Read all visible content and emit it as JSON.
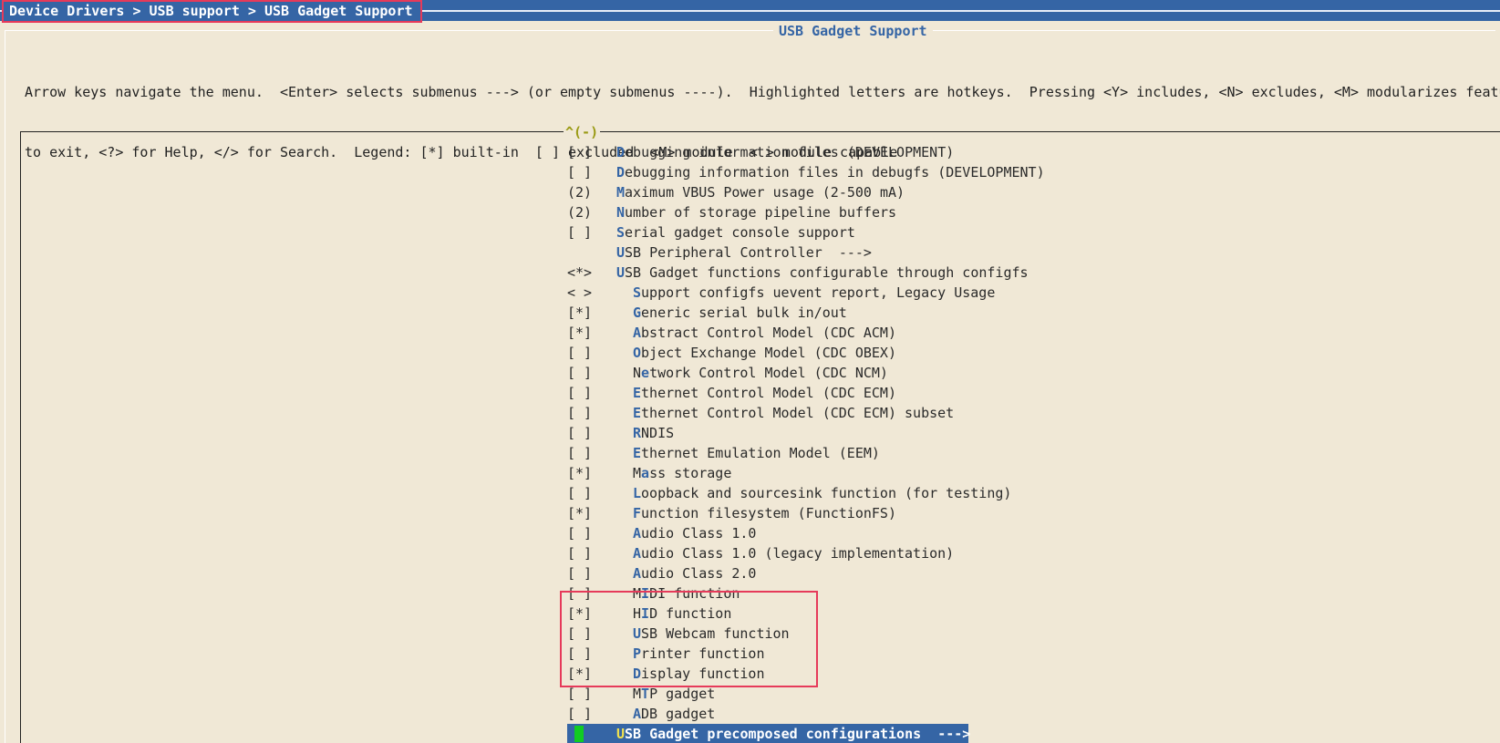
{
  "breadcrumb": "Device Drivers > USB support > USB Gadget Support",
  "dialog_title": "USB Gadget Support",
  "help_lines": [
    "Arrow keys navigate the menu.  <Enter> selects submenus ---> (or empty submenus ----).  Highlighted letters are hotkeys.  Pressing <Y> includes, <N> excludes, <M> modularizes featu",
    "to exit, <?> for Help, </> for Search.  Legend: [*] built-in  [ ] excluded  <M> module  < > module capable"
  ],
  "scroll_indicator": "^(-)",
  "menu_items": [
    {
      "state": "[ ]",
      "hotkey": "D",
      "rest": "ebugging information files (DEVELOPMENT)",
      "indent": false,
      "name": "debugging-info-files"
    },
    {
      "state": "[ ]",
      "hotkey": "D",
      "rest": "ebugging information files in debugfs (DEVELOPMENT)",
      "indent": false,
      "name": "debugging-info-debugfs"
    },
    {
      "state": "(2)",
      "hotkey": "M",
      "rest": "aximum VBUS Power usage (2-500 mA)",
      "indent": false,
      "name": "max-vbus-power"
    },
    {
      "state": "(2)",
      "hotkey": "N",
      "rest": "umber of storage pipeline buffers",
      "indent": false,
      "name": "storage-pipeline-buffers"
    },
    {
      "state": "[ ]",
      "hotkey": "S",
      "rest": "erial gadget console support",
      "indent": false,
      "name": "serial-gadget-console"
    },
    {
      "state": "",
      "hotkey": "U",
      "rest": "SB Peripheral Controller  --->",
      "indent": false,
      "name": "usb-peripheral-controller"
    },
    {
      "state": "<*>",
      "hotkey": "U",
      "rest": "SB Gadget functions configurable through configfs",
      "indent": false,
      "name": "usb-gadget-configfs"
    },
    {
      "state": "< >",
      "hotkey": "S",
      "rest": "upport configfs uevent report, Legacy Usage",
      "indent": true,
      "name": "configfs-uevent-report"
    },
    {
      "state": "[*]",
      "hotkey": "G",
      "rest": "eneric serial bulk in/out",
      "indent": true,
      "name": "generic-serial-bulk"
    },
    {
      "state": "[*]",
      "hotkey": "A",
      "rest": "bstract Control Model (CDC ACM)",
      "indent": true,
      "name": "cdc-acm"
    },
    {
      "state": "[ ]",
      "hotkey": "O",
      "rest": "bject Exchange Model (CDC OBEX)",
      "indent": true,
      "name": "cdc-obex"
    },
    {
      "state": "[ ]",
      "pre": "N",
      "hotkey": "e",
      "rest": "twork Control Model (CDC NCM)",
      "indent": true,
      "name": "cdc-ncm"
    },
    {
      "state": "[ ]",
      "hotkey": "E",
      "rest": "thernet Control Model (CDC ECM)",
      "indent": true,
      "name": "cdc-ecm"
    },
    {
      "state": "[ ]",
      "hotkey": "E",
      "rest": "thernet Control Model (CDC ECM) subset",
      "indent": true,
      "name": "cdc-ecm-subset"
    },
    {
      "state": "[ ]",
      "hotkey": "R",
      "rest": "NDIS",
      "indent": true,
      "name": "rndis"
    },
    {
      "state": "[ ]",
      "hotkey": "E",
      "rest": "thernet Emulation Model (EEM)",
      "indent": true,
      "name": "eem"
    },
    {
      "state": "[*]",
      "pre": "M",
      "hotkey": "a",
      "rest": "ss storage",
      "indent": true,
      "name": "mass-storage"
    },
    {
      "state": "[ ]",
      "hotkey": "L",
      "rest": "oopback and sourcesink function (for testing)",
      "indent": true,
      "name": "loopback-sourcesink"
    },
    {
      "state": "[*]",
      "hotkey": "F",
      "rest": "unction filesystem (FunctionFS)",
      "indent": true,
      "name": "function-filesystem"
    },
    {
      "state": "[ ]",
      "hotkey": "A",
      "rest": "udio Class 1.0",
      "indent": true,
      "name": "audio-class-1"
    },
    {
      "state": "[ ]",
      "hotkey": "A",
      "rest": "udio Class 1.0 (legacy implementation)",
      "indent": true,
      "name": "audio-class-1-legacy"
    },
    {
      "state": "[ ]",
      "hotkey": "A",
      "rest": "udio Class 2.0",
      "indent": true,
      "name": "audio-class-2"
    },
    {
      "state": "[ ]",
      "pre": "M",
      "hotkey": "I",
      "rest": "DI function",
      "indent": true,
      "name": "midi-function"
    },
    {
      "state": "[*]",
      "pre": "H",
      "hotkey": "I",
      "rest": "D function",
      "indent": true,
      "name": "hid-function"
    },
    {
      "state": "[ ]",
      "hotkey": "U",
      "rest": "SB Webcam function",
      "indent": true,
      "name": "usb-webcam-function"
    },
    {
      "state": "[ ]",
      "hotkey": "P",
      "rest": "rinter function",
      "indent": true,
      "name": "printer-function"
    },
    {
      "state": "[*]",
      "hotkey": "D",
      "rest": "isplay function",
      "indent": true,
      "name": "display-function"
    },
    {
      "state": "[ ]",
      "pre": "M",
      "hotkey": "T",
      "rest": "P gadget",
      "indent": true,
      "name": "mtp-gadget"
    },
    {
      "state": "[ ]",
      "hotkey": "A",
      "rest": "DB gadget",
      "indent": true,
      "name": "adb-gadget"
    },
    {
      "state": "",
      "hotkey": "U",
      "rest": "SB Gadget precomposed configurations  --->",
      "indent": false,
      "selected": true,
      "name": "usb-gadget-precomposed"
    }
  ],
  "colors": {
    "background": "#f0e8d6",
    "title_bar": "#3565a5",
    "hotkey": "#3565a5",
    "selected_hotkey": "#f2e24e",
    "cursor": "#11cc22",
    "annotation": "#e63a5a"
  }
}
